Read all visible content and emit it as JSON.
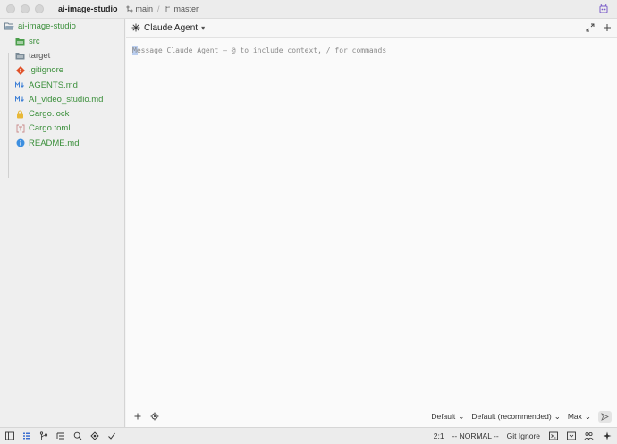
{
  "titlebar": {
    "project": "ai-image-studio",
    "branch": "main",
    "separator": "/",
    "worktree": "master"
  },
  "sidebar": {
    "root": "ai-image-studio",
    "items": [
      {
        "label": "src",
        "icon": "folder-icon",
        "color": "#3b8f3b"
      },
      {
        "label": "target",
        "icon": "folder-icon",
        "color": "#555555"
      },
      {
        "label": ".gitignore",
        "icon": "git-icon",
        "color": "#3b8f3b"
      },
      {
        "label": "AGENTS.md",
        "icon": "markdown-icon",
        "color": "#3b8f3b"
      },
      {
        "label": "AI_video_studio.md",
        "icon": "markdown-icon",
        "color": "#3b8f3b"
      },
      {
        "label": "Cargo.lock",
        "icon": "lock-icon",
        "color": "#3b8f3b"
      },
      {
        "label": "Cargo.toml",
        "icon": "toml-icon",
        "color": "#3b8f3b"
      },
      {
        "label": "README.md",
        "icon": "info-icon",
        "color": "#3b8f3b"
      }
    ]
  },
  "agent": {
    "title": "Claude Agent",
    "placeholder": "Message Claude Agent — @ to include context, / for commands",
    "mode": "Default",
    "model": "Default (recommended)",
    "effort": "Max"
  },
  "statusbar": {
    "position": "2:1",
    "vim_mode": "-- NORMAL --",
    "git_ignore": "Git Ignore"
  },
  "colors": {
    "accent_green": "#3b8f3b",
    "git_orange": "#e0522a",
    "markdown_blue": "#3d7fd6",
    "lock_yellow": "#e8b838"
  }
}
